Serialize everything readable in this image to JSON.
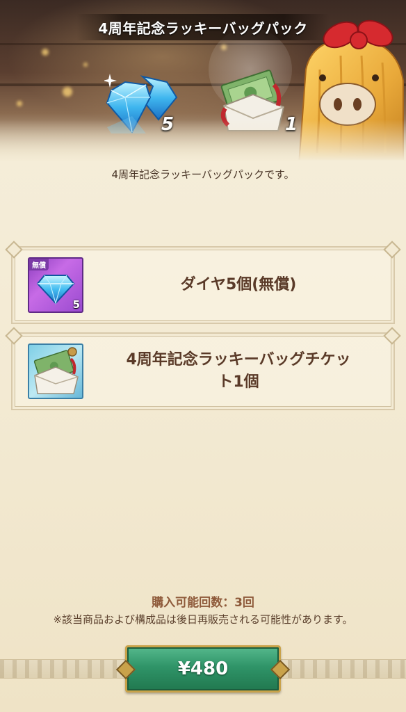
{
  "banner": {
    "title": "4周年記念ラッキーバッグパック",
    "diamond_count": "5",
    "ticket_count": "1"
  },
  "description": "4周年記念ラッキーバッグパックです。",
  "items": [
    {
      "icon": "diamond-icon",
      "tag": "無償",
      "icon_count": "5",
      "label": "ダイヤ5個(無償)"
    },
    {
      "icon": "lucky-bag-ticket-icon",
      "label_line1": "4周年記念ラッキーバッグチケッ",
      "label_line2": "ト1個"
    }
  ],
  "purchase_limit": "購入可能回数：3回",
  "notice": "※該当商品および構成品は後日再販売される可能性があります。",
  "price_button": "¥480",
  "colors": {
    "button_green": "#2f9468",
    "button_border": "#c9a24a",
    "diamond_bg": "#9a4bd0",
    "ticket_bg": "#7fcfe6",
    "text_brown": "#5a3a28"
  }
}
